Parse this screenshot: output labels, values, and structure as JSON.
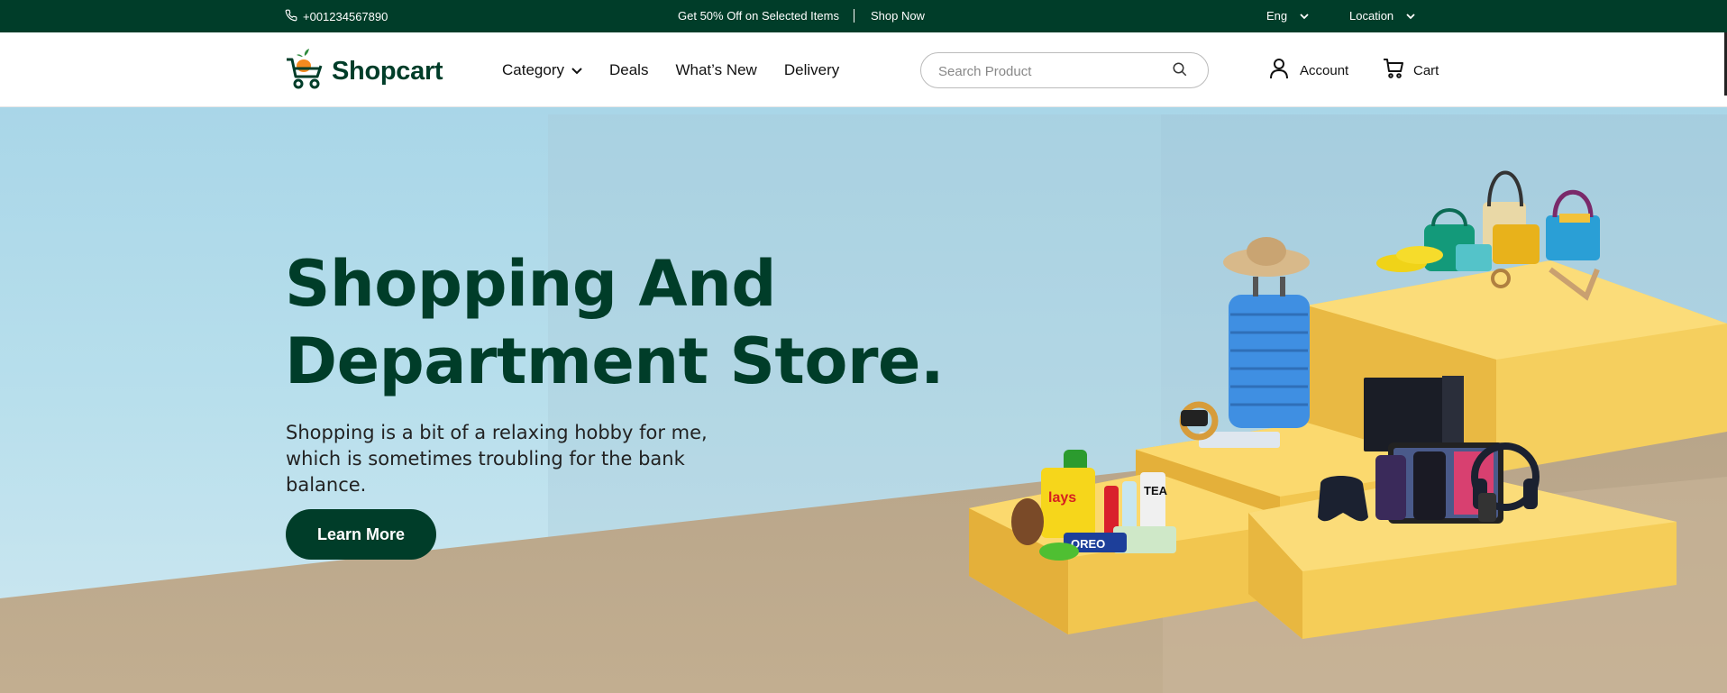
{
  "topbar": {
    "phone": "+001234567890",
    "promo_text": "Get 50% Off on Selected Items",
    "promo_link": "Shop Now",
    "language": "Eng",
    "location": "Location"
  },
  "header": {
    "brand": "Shopcart",
    "nav": {
      "category": "Category",
      "deals": "Deals",
      "whats_new": "What’s New",
      "delivery": "Delivery"
    },
    "search_placeholder": "Search Product",
    "account": "Account",
    "cart": "Cart"
  },
  "hero": {
    "title_line1": "Shopping And",
    "title_line2": "Department Store.",
    "subtitle": "Shopping is a bit of a relaxing hobby for me, which is sometimes troubling for the bank balance.",
    "cta": "Learn More",
    "snack_labels": {
      "lays": "lays",
      "tea": "TEA",
      "oreo": "OREO"
    }
  },
  "colors": {
    "brand_green": "#003d29",
    "accent_orange": "#f58a1f",
    "podium_yellow": "#f2c94c",
    "sky": "#a9d6e8",
    "floor": "#b9a588"
  },
  "icons": [
    "phone-icon",
    "chevron-down-icon",
    "cart-logo-icon",
    "search-icon",
    "user-icon",
    "cart-icon"
  ]
}
